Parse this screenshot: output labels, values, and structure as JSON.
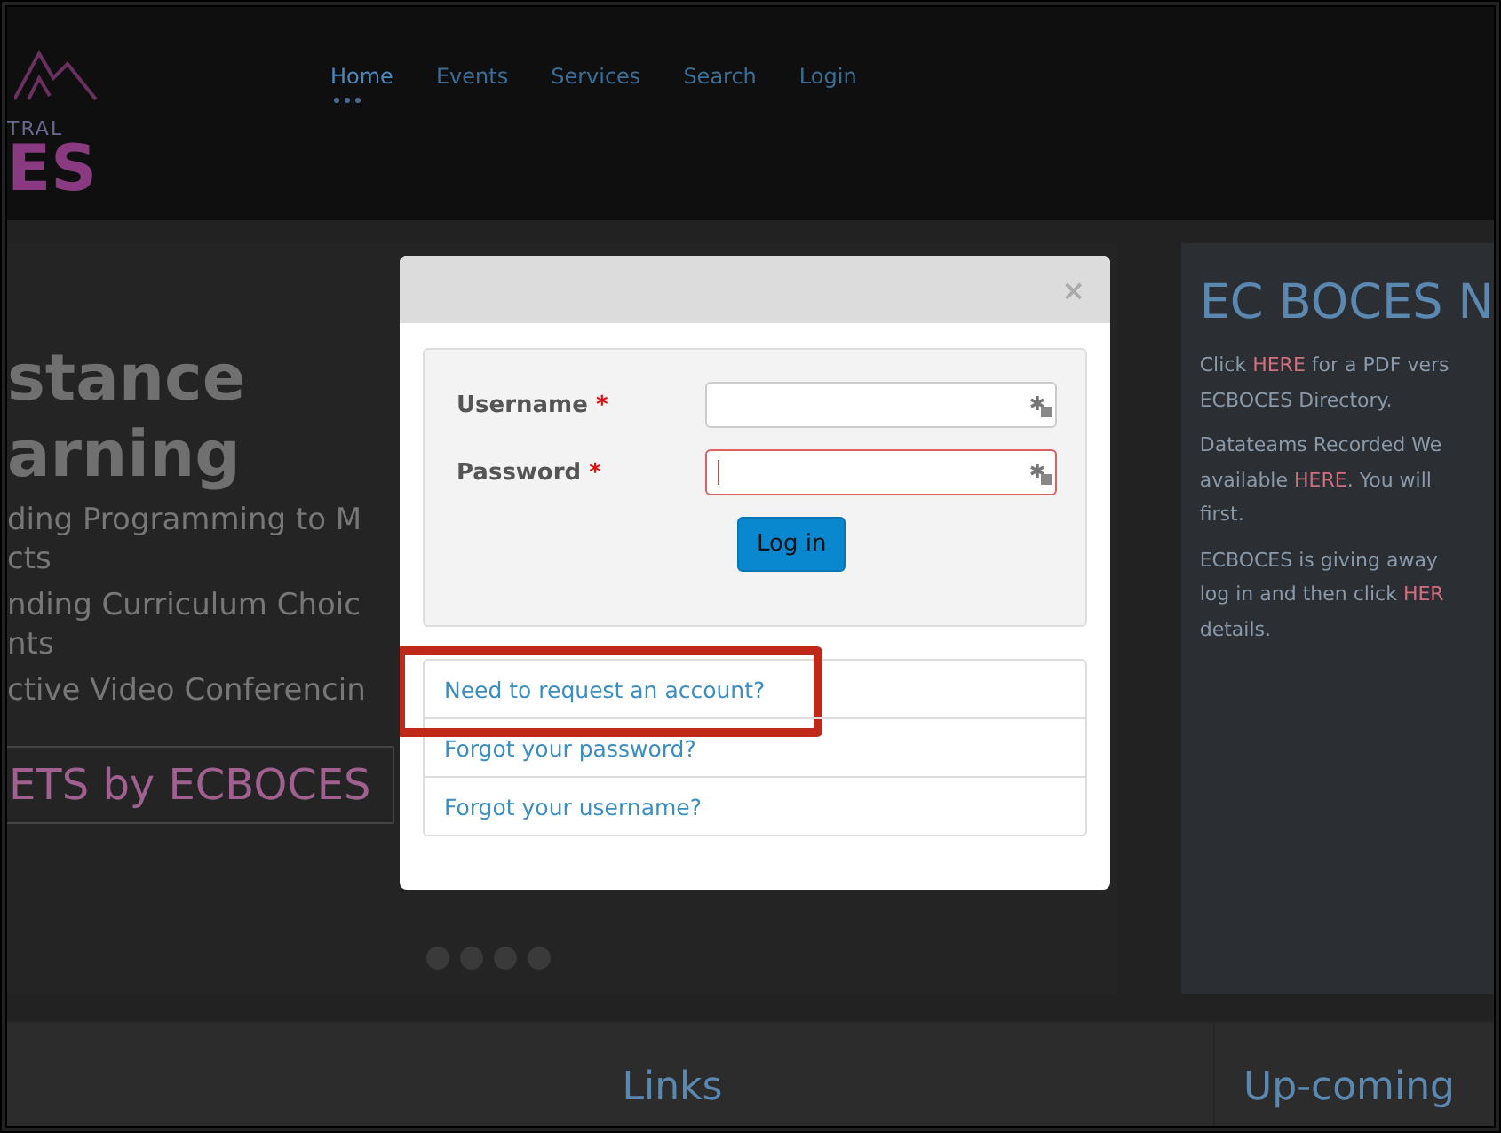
{
  "logo": {
    "line_1": "TRAL",
    "line_2": "ES"
  },
  "nav": [
    {
      "label": "Home",
      "selected": true
    },
    {
      "label": "Events",
      "selected": false
    },
    {
      "label": "Services",
      "selected": false
    },
    {
      "label": "Search",
      "selected": false
    },
    {
      "label": "Login",
      "selected": false
    }
  ],
  "hero": {
    "title_lines": [
      "stance",
      "arning"
    ],
    "bullets": [
      [
        "ding Programming to M",
        "cts"
      ],
      [
        "nding Curriculum Choic",
        "nts"
      ],
      [
        "ctive Video Conferencin"
      ]
    ],
    "button": "ETS by ECBOCES",
    "carousel": [
      {
        "selected": false
      },
      {
        "selected": false
      },
      {
        "selected": false
      },
      {
        "selected": false
      }
    ]
  },
  "news": {
    "title": "EC BOCES N",
    "paragraphs": [
      [
        [
          {
            "text": "Click "
          },
          {
            "text": "HERE",
            "kind": "link"
          },
          {
            "text": " for a PDF vers"
          }
        ],
        [
          {
            "text": "ECBOCES Directory."
          }
        ]
      ],
      [
        [
          {
            "text": "Datateams Recorded We"
          }
        ],
        [
          {
            "text": "available "
          },
          {
            "text": "HERE",
            "kind": "link"
          },
          {
            "text": ".  You will"
          }
        ],
        [
          {
            "text": "first."
          }
        ]
      ],
      [
        [
          {
            "text": "ECBOCES is giving away"
          }
        ],
        [
          {
            "text": "log in and then click "
          },
          {
            "text": "HER",
            "kind": "link"
          }
        ],
        [
          {
            "text": "details."
          }
        ]
      ]
    ]
  },
  "footer": {
    "links_title": "Links",
    "upcoming_title": "Up-coming"
  },
  "modal": {
    "close": "×",
    "fields": [
      {
        "label": "Username",
        "required": "*",
        "invalid": false,
        "focused": false
      },
      {
        "label": "Password",
        "required": "*",
        "invalid": true,
        "focused": true
      }
    ],
    "submit": "Log in",
    "links": [
      {
        "label": "Need to request an account?",
        "highlighted": true
      },
      {
        "label": "Forgot your password?",
        "highlighted": false
      },
      {
        "label": "Forgot your username?",
        "highlighted": false
      }
    ]
  }
}
